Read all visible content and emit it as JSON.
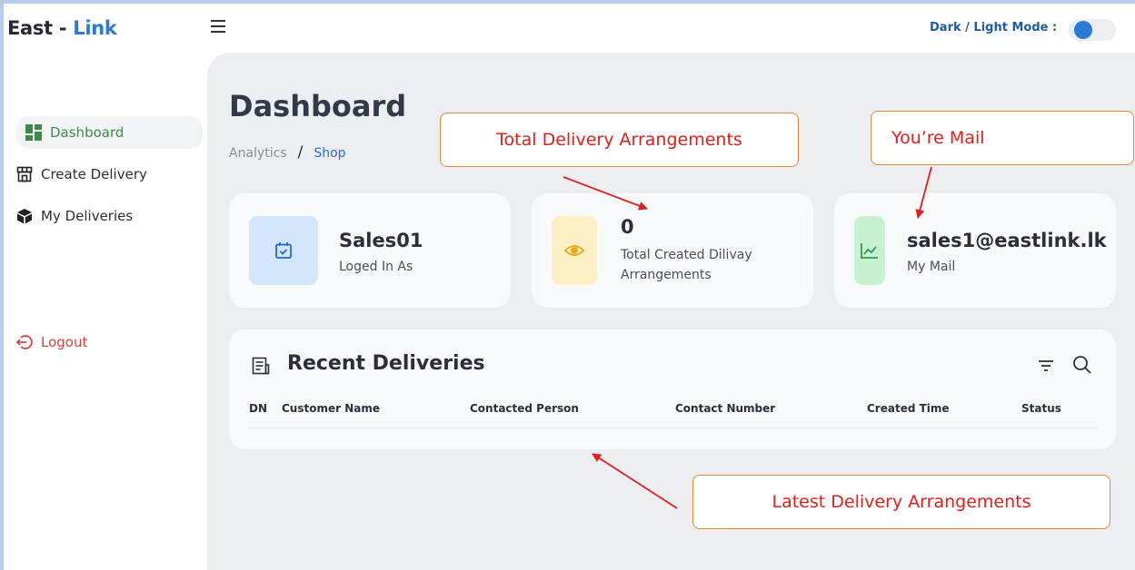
{
  "header": {
    "logo_main": "East - ",
    "logo_accent": "Link",
    "mode_label": "Dark / Light Mode :",
    "mode_on": true
  },
  "sidebar": {
    "items": [
      {
        "label": "Dashboard",
        "icon": "grid-icon",
        "active": true
      },
      {
        "label": "Create Delivery",
        "icon": "store-icon",
        "active": false
      },
      {
        "label": "My Deliveries",
        "icon": "box-icon",
        "active": false
      }
    ],
    "logout_label": "Logout"
  },
  "page": {
    "title": "Dashboard",
    "breadcrumb": [
      "Analytics",
      "/",
      "Shop"
    ]
  },
  "cards": [
    {
      "value": "Sales01",
      "label": "Loged In As",
      "icon": "calendar-check-icon"
    },
    {
      "value": "0",
      "label": "Total Created Dilivay Arrangements",
      "icon": "eye-icon"
    },
    {
      "value": "sales1@eastlink.lk",
      "label": "My Mail",
      "icon": "chart-line-icon"
    }
  ],
  "recent": {
    "title": "Recent Deliveries",
    "columns": [
      "DN",
      "Customer Name",
      "Contacted Person",
      "Contact Number",
      "Created Time",
      "Status"
    ]
  },
  "annotations": {
    "total": "Total Delivery Arrangements",
    "mail": "You’re Mail",
    "latest": "Latest Delivery Arrangements"
  },
  "colors": {
    "accent": "#2a7ad6",
    "active_nav": "#3d8b48",
    "logout": "#d8413a",
    "callout_text": "#e0201c",
    "callout_border": "#e08a3c"
  }
}
